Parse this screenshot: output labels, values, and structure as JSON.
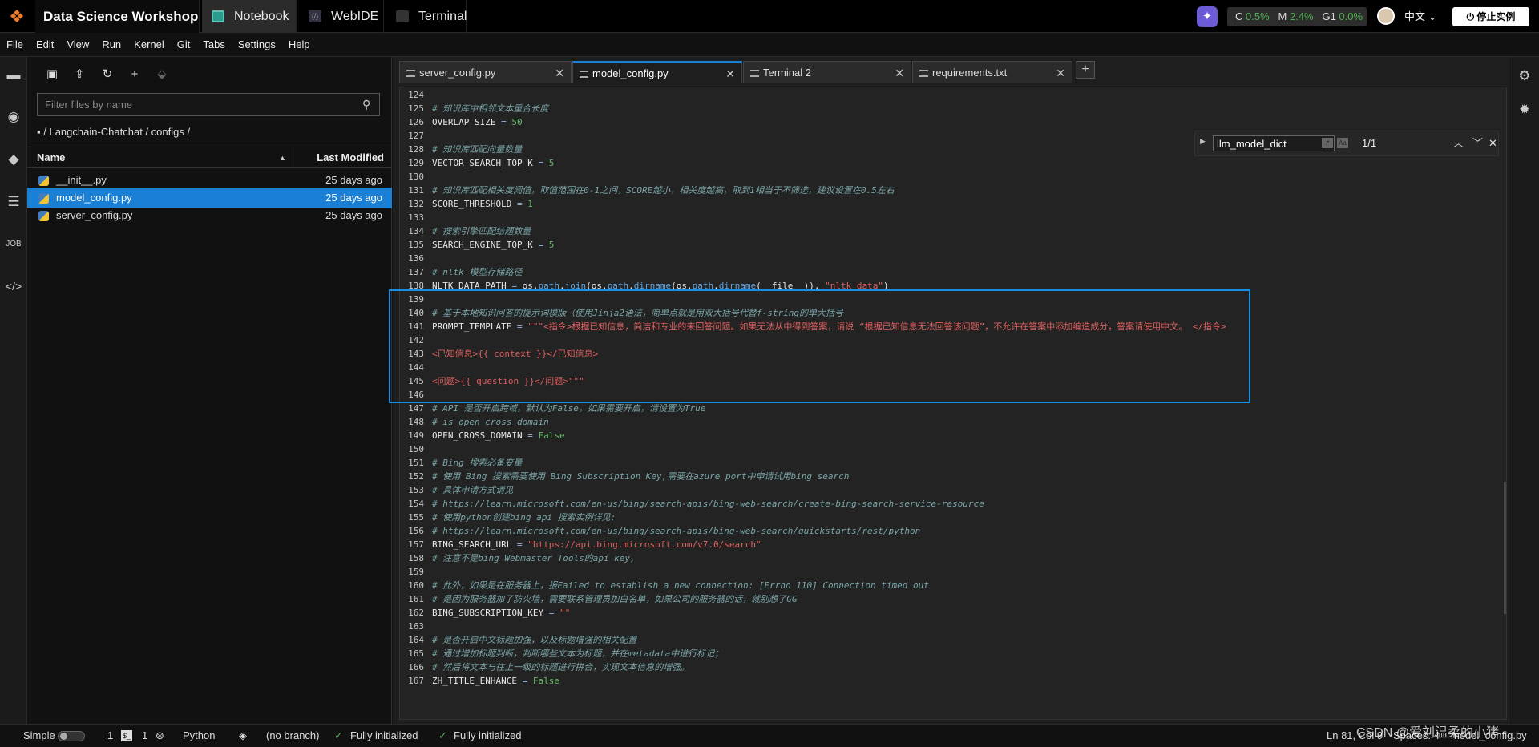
{
  "app": {
    "brand": "Data Science Workshop",
    "top_tabs": [
      "Notebook",
      "WebIDE",
      "Terminal"
    ],
    "webide_icon_text": "{/}",
    "resources": {
      "c_label": "C",
      "c_val": "0.5%",
      "m_label": "M",
      "m_val": "2.4%",
      "g_label": "G1",
      "g_val": "0.0%"
    },
    "language": "中文",
    "stop_label": "停止实例",
    "accent_color": "#1a80d5"
  },
  "menu": [
    "File",
    "Edit",
    "View",
    "Run",
    "Kernel",
    "Git",
    "Tabs",
    "Settings",
    "Help"
  ],
  "filebrowser": {
    "filter_placeholder": "Filter files by name",
    "breadcrumb": "/ Langchain-Chatchat / configs /",
    "col_name": "Name",
    "col_modified": "Last Modified",
    "files": [
      {
        "name": "__init__.py",
        "modified": "25 days ago"
      },
      {
        "name": "model_config.py",
        "modified": "25 days ago"
      },
      {
        "name": "server_config.py",
        "modified": "25 days ago"
      }
    ]
  },
  "editor": {
    "tabs": [
      "server_config.py",
      "model_config.py",
      "Terminal 2",
      "requirements.txt"
    ],
    "search_value": "llm_model_dict",
    "search_count": "1/1",
    "line_numbers": [
      "124",
      "125",
      "126",
      "127",
      "128",
      "129",
      "130",
      "131",
      "132",
      "133",
      "134",
      "135",
      "136",
      "137",
      "138",
      "139",
      "140",
      "141",
      "142",
      "143",
      "144",
      "145",
      "146",
      "147",
      "148",
      "149",
      "150",
      "151",
      "152",
      "153",
      "154",
      "155",
      "156",
      "157",
      "158",
      "159",
      "160",
      "161",
      "162",
      "163",
      "164",
      "165",
      "166",
      "167"
    ],
    "lines": {
      "l125": "# 知识库中相邻文本重合长度",
      "l126a": "OVERLAP_SIZE",
      "l126b": " = ",
      "l126c": "50",
      "l128": "# 知识库匹配向量数量",
      "l129a": "VECTOR_SEARCH_TOP_K",
      "l129b": " = ",
      "l129c": "5",
      "l131": "# 知识库匹配相关度阈值，取值范围在0-1之间，SCORE越小，相关度越高，取到1相当于不筛选，建议设置在0.5左右",
      "l132a": "SCORE_THRESHOLD",
      "l132b": " = ",
      "l132c": "1",
      "l134": "# 搜索引擎匹配结题数量",
      "l135a": "SEARCH_ENGINE_TOP_K",
      "l135b": " = ",
      "l135c": "5",
      "l137": "# nltk 模型存储路径",
      "l138a": "NLTK_DATA_PATH",
      "l138b": " = ",
      "l138c": "os.",
      "l138d": "path",
      "l138e": ".",
      "l138f": "join",
      "l138g": "(os.",
      "l138h": "path",
      "l138i": ".",
      "l138j": "dirname",
      "l138k": "(os.",
      "l138l": "path",
      "l138m": ".",
      "l138n": "dirname",
      "l138o": "(__file__)), ",
      "l138p": "\"nltk_data\"",
      "l138q": ")",
      "l140": "# 基于本地知识问答的提示词模版（使用Jinja2语法，简单点就是用双大括号代替f-string的单大括号",
      "l141a": "PROMPT_TEMPLATE",
      "l141b": " = ",
      "l141c": "\"\"\"<指令>根据已知信息，简洁和专业的来回答问题。如果无法从中得到答案，请说 “根据已知信息无法回答该问题”，不允许在答案中添加编造成分，答案请使用中文。 </指令>",
      "l143": "<已知信息>{{ context }}</已知信息>",
      "l145": "<问题>{{ question }}</问题>\"\"\"",
      "l147": "# API 是否开启跨域，默认为False，如果需要开启，请设置为True",
      "l148": "# is open cross domain",
      "l149a": "OPEN_CROSS_DOMAIN",
      "l149b": " = ",
      "l149c": "False",
      "l151": "# Bing 搜索必备变量",
      "l152": "# 使用 Bing 搜索需要使用 Bing Subscription Key,需要在azure port中申请试用bing search",
      "l153": "# 具体申请方式请见",
      "l154": "# https://learn.microsoft.com/en-us/bing/search-apis/bing-web-search/create-bing-search-service-resource",
      "l155": "# 使用python创建bing api 搜索实例详见:",
      "l156": "# https://learn.microsoft.com/en-us/bing/search-apis/bing-web-search/quickstarts/rest/python",
      "l157a": "BING_SEARCH_URL",
      "l157b": " = ",
      "l157c": "\"https://api.bing.microsoft.com/v7.0/search\"",
      "l158": "# 注意不是bing Webmaster Tools的api key,",
      "l160": "# 此外，如果是在服务器上，报Failed to establish a new connection: [Errno 110] Connection timed out",
      "l161": "# 是因为服务器加了防火墙，需要联系管理员加白名单，如果公司的服务器的话，就别想了GG",
      "l162a": "BING_SUBSCRIPTION_KEY",
      "l162b": " = ",
      "l162c": "\"\"",
      "l164": "# 是否开启中文标题加强，以及标题增强的相关配置",
      "l165": "# 通过增加标题判断，判断哪些文本为标题，并在metadata中进行标记；",
      "l166": "# 然后将文本与往上一级的标题进行拼合，实现文本信息的增强。",
      "l167a": "ZH_TITLE_ENHANCE",
      "l167b": " = ",
      "l167c": "False"
    }
  },
  "status": {
    "mode": "Simple",
    "n1": "1",
    "term_badge": "$_",
    "n2": "1",
    "kernel": "Python",
    "branch": "(no branch)",
    "init1": "Fully initialized",
    "init2": "Fully initialized",
    "cursor": "Ln 81, Col 9",
    "spaces": "Spaces: 4",
    "file": "model_config.py"
  },
  "watermark": "CSDN @爱刘温柔的小猪"
}
